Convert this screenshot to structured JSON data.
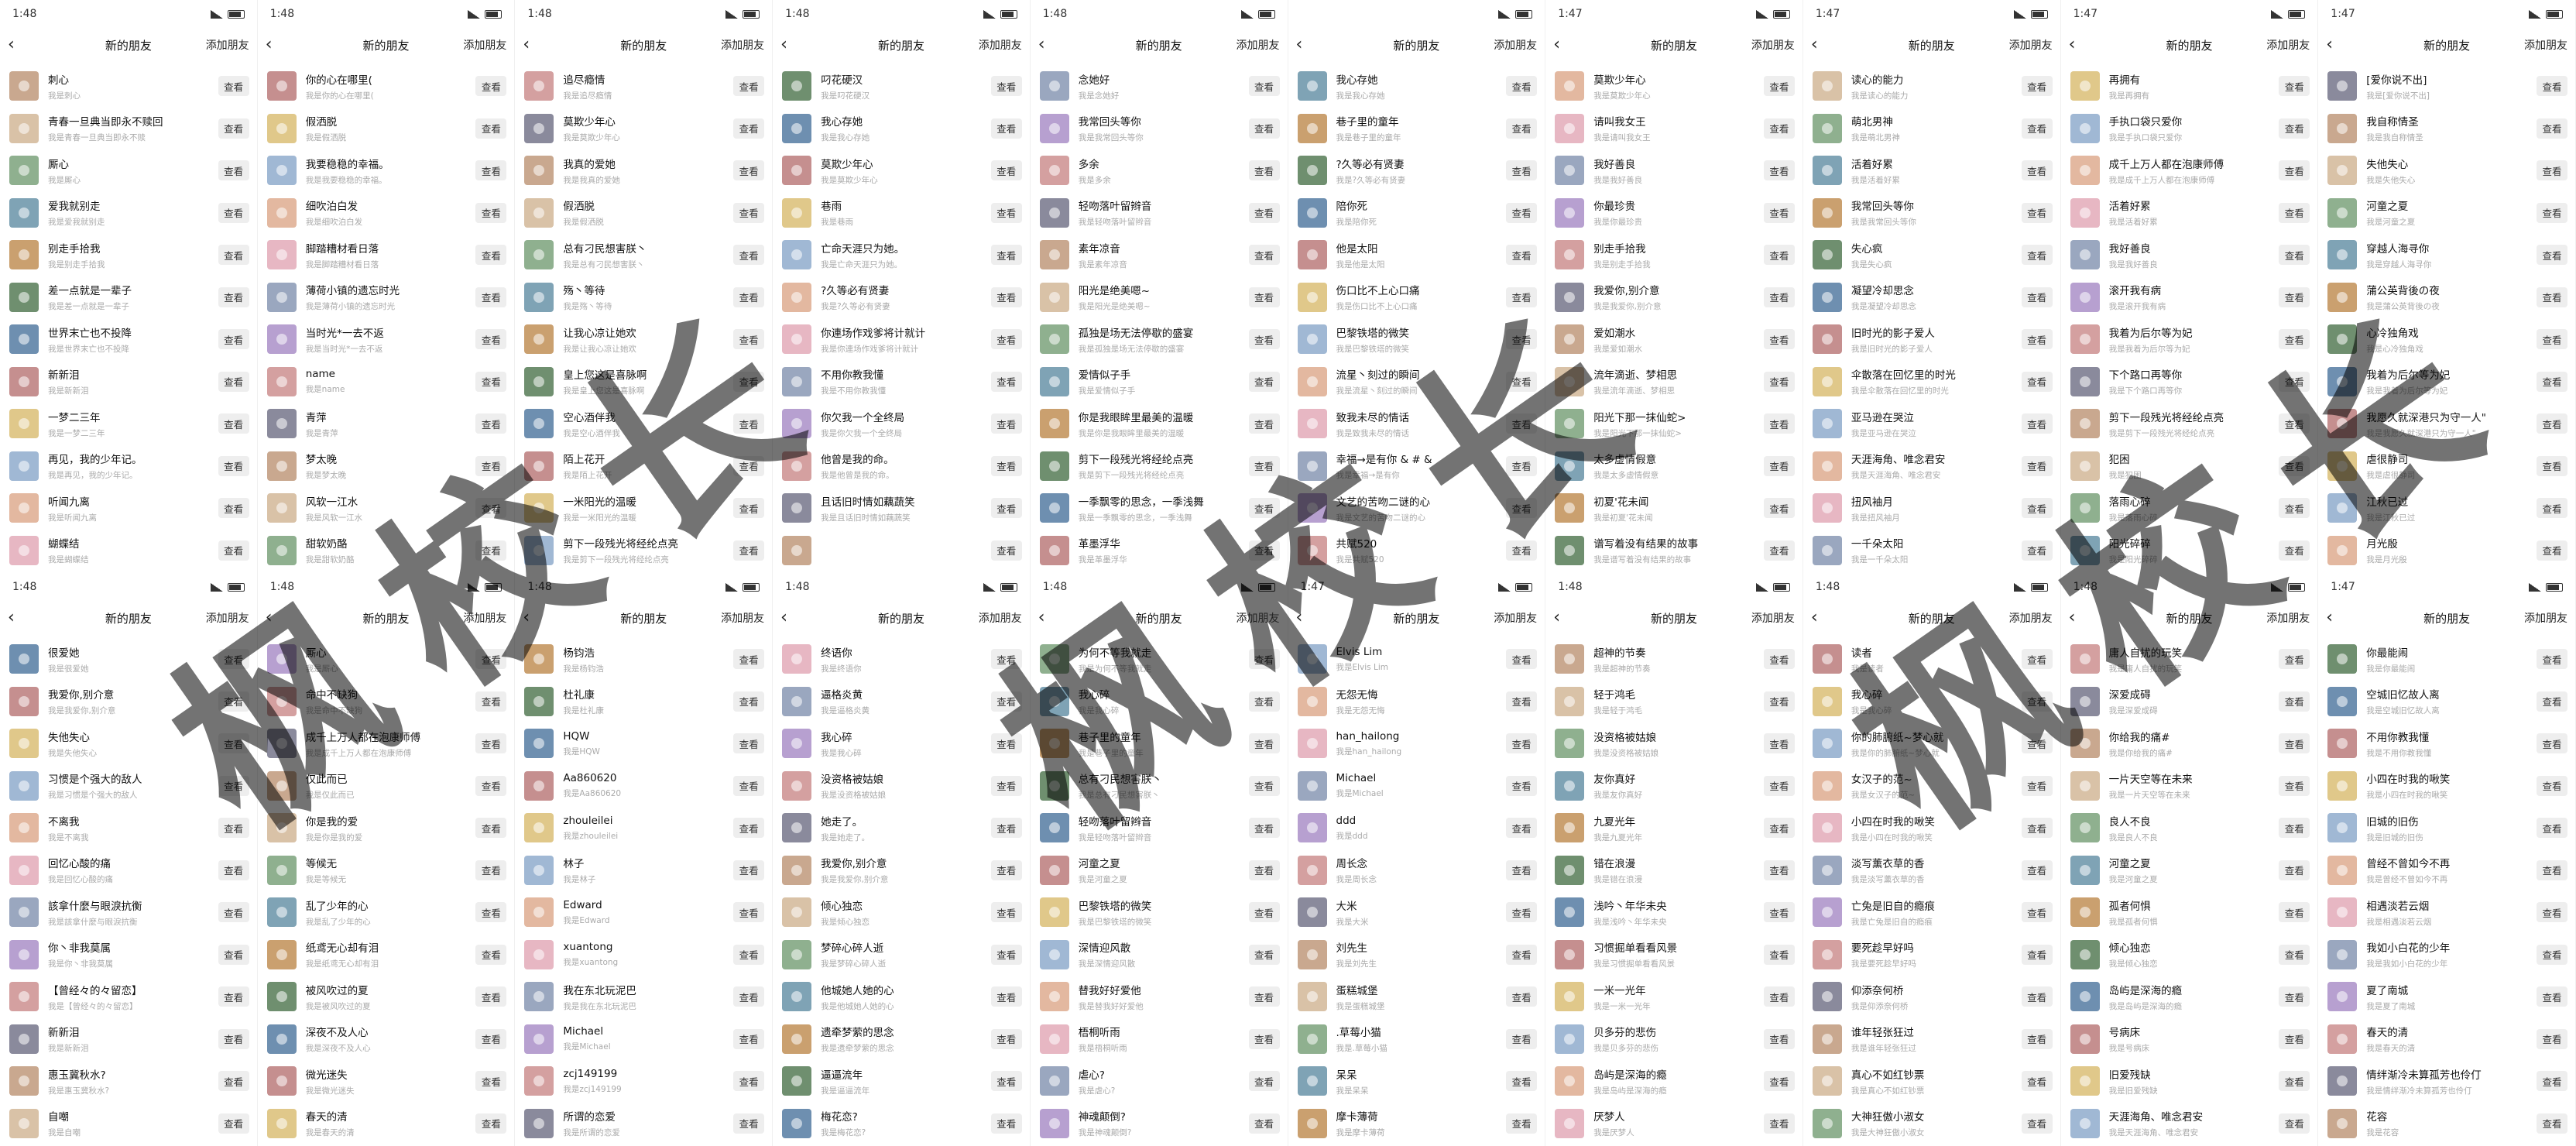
{
  "watermark": "枫校长",
  "ui": {
    "title": "新的朋友",
    "add_label": "添加朋友",
    "view_label": "查看"
  },
  "panels": [
    {
      "time": "1:48",
      "friends": [
        {
          "name": "刺心",
          "sub": "我是刺心"
        },
        {
          "name": "青春一旦典当即永不赎回",
          "sub": "我是青春一旦典当即永不赎"
        },
        {
          "name": "厮心",
          "sub": "我是厮心"
        },
        {
          "name": "爱我就别走",
          "sub": "我是爱我就别走"
        },
        {
          "name": "别走手拾我",
          "sub": "我是别走手拾我"
        },
        {
          "name": "差一点就是一辈子",
          "sub": "我是差一点就是一辈子"
        },
        {
          "name": "世界末亡也不投降",
          "sub": "我是世界末亡也不投降"
        },
        {
          "name": "新新泪",
          "sub": "我是新新泪"
        },
        {
          "name": "一梦二三年",
          "sub": "我是一梦二三年"
        },
        {
          "name": "再见，我的少年记。",
          "sub": "我是再见，我的少年记。"
        },
        {
          "name": "听闻九离",
          "sub": "我是听闻九离"
        },
        {
          "name": "蝴蝶结",
          "sub": "我是蝴蝶结"
        }
      ]
    },
    {
      "time": "1:48",
      "friends": [
        {
          "name": "你的心在哪里(",
          "sub": "我是你的心在哪里("
        },
        {
          "name": "假洒脱",
          "sub": "我是假洒脱"
        },
        {
          "name": "我要稳稳的幸福。",
          "sub": "我是我要稳稳的幸福。"
        },
        {
          "name": "细吹泊白发",
          "sub": "我是细吹泊白发"
        },
        {
          "name": "脚踏糟材看日落",
          "sub": "我是脚踏糟材看日落"
        },
        {
          "name": "薄荷小镇的遗忘时光",
          "sub": "我是薄荷小镇的遗忘时光"
        },
        {
          "name": "当时光*一去不返",
          "sub": "我是当时光*一去不返"
        },
        {
          "name": "name",
          "sub": "我是name"
        },
        {
          "name": "青萍",
          "sub": "我是青萍"
        },
        {
          "name": "梦太晚",
          "sub": "我是梦太晚"
        },
        {
          "name": "风软一江水",
          "sub": "我是风软一江水"
        },
        {
          "name": "甜软奶酪",
          "sub": "我是甜软奶酪"
        }
      ]
    },
    {
      "time": "1:48",
      "friends": [
        {
          "name": "追尽瘾情",
          "sub": "我是追尽瘾情"
        },
        {
          "name": "莫欺少年心",
          "sub": "我是莫欺少年心"
        },
        {
          "name": "我真的爱她",
          "sub": "我是我真的爱她"
        },
        {
          "name": "假洒脱",
          "sub": "我是假洒脱"
        },
        {
          "name": "总有刁民想害朕丶",
          "sub": "我是总有刁民想害朕丶"
        },
        {
          "name": "殇丶等待",
          "sub": "我是殇丶等待"
        },
        {
          "name": "让我心凉让她欢",
          "sub": "我是让我心凉让她欢"
        },
        {
          "name": "皇上您这是喜脉啊",
          "sub": "我是皇上您这是喜脉啊"
        },
        {
          "name": "空心酒伴我",
          "sub": "我是空心酒伴我"
        },
        {
          "name": "陌上花开",
          "sub": "我是陌上花开"
        },
        {
          "name": "一米阳光的温暖",
          "sub": "我是一米阳光的温暖"
        },
        {
          "name": "剪下一段残光将经纶点亮",
          "sub": "我是剪下一段残光将经纶点亮"
        }
      ]
    },
    {
      "time": "1:48",
      "friends": [
        {
          "name": "叼花硬汉",
          "sub": "我是叼花硬汉"
        },
        {
          "name": "我心存她",
          "sub": "我是我心存她"
        },
        {
          "name": "莫欺少年心",
          "sub": "我是莫欺少年心"
        },
        {
          "name": "巷雨",
          "sub": "我是巷雨"
        },
        {
          "name": "亡命天涯只为她。",
          "sub": "我是亡命天涯只为她。"
        },
        {
          "name": "?久等必有贤妻",
          "sub": "我是?久等必有贤妻"
        },
        {
          "name": "你連场作戏爹将计就计",
          "sub": "我是你連场作戏爹将计就计"
        },
        {
          "name": "不用你教我懂",
          "sub": "我是不用你教我懂"
        },
        {
          "name": "你欠我一个全终局",
          "sub": "我是你欠我一个全终局"
        },
        {
          "name": "他曾是我的命。",
          "sub": "我是他曾是我的命。"
        },
        {
          "name": "且话旧时情如藕蔬笑",
          "sub": "我是且话旧时情如藕蔬笑"
        },
        {
          "name": "",
          "sub": ""
        }
      ]
    },
    {
      "time": "1:48",
      "friends": [
        {
          "name": "念她好",
          "sub": "我是念她好"
        },
        {
          "name": "我常回头等你",
          "sub": "我是我常回头等你"
        },
        {
          "name": "多余",
          "sub": "我是多余"
        },
        {
          "name": "轻吻落叶留辫音",
          "sub": "我是轻吻落叶留辫音"
        },
        {
          "name": "素年凉音",
          "sub": "我是素年凉音"
        },
        {
          "name": "阳光是绝美嗯~",
          "sub": "我是阳光是绝美嗯~"
        },
        {
          "name": "孤独是场无法停歇的盛宴",
          "sub": "我是孤独是场无法停歇的盛宴"
        },
        {
          "name": "爱情似子手",
          "sub": "我是爱情似子手"
        },
        {
          "name": "你是我眼眸里最美的温暖",
          "sub": "我是你是我眼眸里最美的温暖"
        },
        {
          "name": "剪下一段残光将经纶点亮",
          "sub": "我是剪下一段残光将经纶点亮"
        },
        {
          "name": "一季飘零的思念，一季浅舞",
          "sub": "我是一季飘零的思念，一季浅舞"
        },
        {
          "name": "革墨浮华",
          "sub": "我是革墨浮华"
        }
      ]
    },
    {
      "time": "",
      "friends": [
        {
          "name": "我心存她",
          "sub": "我是我心存她"
        },
        {
          "name": "巷子里的童年",
          "sub": "我是巷子里的童年"
        },
        {
          "name": "?久等必有贤妻",
          "sub": "我是?久等必有贤妻"
        },
        {
          "name": "陪你死",
          "sub": "我是陪你死"
        },
        {
          "name": "他是太阳",
          "sub": "我是他是太阳"
        },
        {
          "name": "伤口比不上心口痛",
          "sub": "我是伤口比不上心口痛"
        },
        {
          "name": "巴黎铁塔的微笑",
          "sub": "我是巴黎铁塔的微笑"
        },
        {
          "name": "流星丶刻过的瞬间",
          "sub": "我是流星丶刻过的瞬间"
        },
        {
          "name": "致我未尽的情话",
          "sub": "我是致我未尽的情话"
        },
        {
          "name": "幸福→是有你 &  # &",
          "sub": "我是幸福→是有你"
        },
        {
          "name": "文艺的苦吻二谜的心",
          "sub": "我是文艺的苦吻二谜的心"
        },
        {
          "name": "共赋520",
          "sub": "我是共赋520"
        }
      ]
    },
    {
      "time": "1:47",
      "friends": [
        {
          "name": "莫欺少年心",
          "sub": "我是莫欺少年心"
        },
        {
          "name": "请叫我女王",
          "sub": "我是请叫我女王"
        },
        {
          "name": "我好善良",
          "sub": "我是我好善良"
        },
        {
          "name": "你最珍贵",
          "sub": "我是你最珍贵"
        },
        {
          "name": "别走手拾我",
          "sub": "我是别走手拾我"
        },
        {
          "name": "我爱你,别介意",
          "sub": "我是我爱你,别介意"
        },
        {
          "name": "爱如潮水",
          "sub": "我是爱如潮水"
        },
        {
          "name": "流年滴逝、梦相思",
          "sub": "我是流年滴逝、梦相思"
        },
        {
          "name": "阳光下那一抹仙蛇>",
          "sub": "我是阳光下那一抹仙蛇>"
        },
        {
          "name": "太多虚情假意",
          "sub": "我是太多虚情假意"
        },
        {
          "name": "初夏'花未闻",
          "sub": "我是初夏'花未闻"
        },
        {
          "name": "谱写着没有结果的故事",
          "sub": "我是谱写着没有结果的故事"
        }
      ]
    },
    {
      "time": "1:47",
      "friends": [
        {
          "name": "读心的能力",
          "sub": "我是读心的能力"
        },
        {
          "name": "萌北男神",
          "sub": "我是萌北男神"
        },
        {
          "name": "活着好累",
          "sub": "我是活着好累"
        },
        {
          "name": "我常回头等你",
          "sub": "我是我常回头等你"
        },
        {
          "name": "失心疯",
          "sub": "我是失心疯"
        },
        {
          "name": "凝望冷却思念",
          "sub": "我是凝望冷却思念"
        },
        {
          "name": "旧时光的影子爱人",
          "sub": "我是旧时光的影子爱人"
        },
        {
          "name": "伞散落在回忆里的时光",
          "sub": "我是伞散落在回忆里的时光"
        },
        {
          "name": "亚马逊在哭泣",
          "sub": "我是亚马逊在哭泣"
        },
        {
          "name": "天涯海角、唯念君安",
          "sub": "我是天涯海角、唯念君安"
        },
        {
          "name": "扭风袖月",
          "sub": "我是扭风袖月"
        },
        {
          "name": "一千朵太阳",
          "sub": "我是一千朵太阳"
        }
      ]
    },
    {
      "time": "1:47",
      "friends": [
        {
          "name": "再拥有",
          "sub": "我是再拥有"
        },
        {
          "name": "手执口袋只爱你",
          "sub": "我是手执口袋只爱你"
        },
        {
          "name": "成千上万人都在泡康师傅",
          "sub": "我是成千上万人都在泡康师傅"
        },
        {
          "name": "活着好累",
          "sub": "我是活着好累"
        },
        {
          "name": "我好善良",
          "sub": "我是我好善良"
        },
        {
          "name": "滚开我有病",
          "sub": "我是滚开我有病"
        },
        {
          "name": "我着为后尔等为妃",
          "sub": "我是我着为后尔等为妃"
        },
        {
          "name": "下个路口再等你",
          "sub": "我是下个路口再等你"
        },
        {
          "name": "剪下一段残光将经纶点亮",
          "sub": "我是剪下一段残光将经纶点亮"
        },
        {
          "name": "犯困",
          "sub": "我是犯困"
        },
        {
          "name": "落雨心碎",
          "sub": "我是落雨心碎"
        },
        {
          "name": "阳光碎碎",
          "sub": "我是阳光碎碎"
        }
      ]
    },
    {
      "time": "1:47",
      "friends": [
        {
          "name": "[爱你说不出]",
          "sub": "我是[爱你说不出]"
        },
        {
          "name": "我自称情圣",
          "sub": "我是我自称情圣"
        },
        {
          "name": "失他失心",
          "sub": "我是失他失心"
        },
        {
          "name": "河童之夏",
          "sub": "我是河童之夏"
        },
        {
          "name": "穿越人海寻你",
          "sub": "我是穿越人海寻你"
        },
        {
          "name": "蒲公英背後の夜",
          "sub": "我是蒲公英背後の夜"
        },
        {
          "name": "心冷独角戏",
          "sub": "我是心冷独角戏"
        },
        {
          "name": "我着为后尔等为妃",
          "sub": "我是我着为后尔等为妃"
        },
        {
          "name": "我愿久就深港只为守一人\"",
          "sub": "我是我愿久就深港只为守一人\""
        },
        {
          "name": "虐很静司",
          "sub": "我是虐很静司"
        },
        {
          "name": "江秋已过",
          "sub": "我是江秋已过"
        },
        {
          "name": "月光殷",
          "sub": "我是月光殷"
        }
      ]
    },
    {
      "time": "1:48",
      "friends": [
        {
          "name": "很爱她",
          "sub": "我是很爱她"
        },
        {
          "name": "我爱你,别介意",
          "sub": "我是我爱你,别介意"
        },
        {
          "name": "失他失心",
          "sub": "我是失他失心"
        },
        {
          "name": "习惯是个强大的敌人",
          "sub": "我是习惯是个强大的敌人"
        },
        {
          "name": "不离我",
          "sub": "我是不离我"
        },
        {
          "name": "回忆心酸的痛",
          "sub": "我是回忆心酸的痛"
        },
        {
          "name": "該拿什麼与眼淚抗衡",
          "sub": "我是該拿什麼与眼淚抗衡"
        },
        {
          "name": "你丶非我莫属",
          "sub": "我是你丶非我莫属"
        },
        {
          "name": "【曾经々的々留恋】",
          "sub": "我是【曾经々的々留恋】"
        },
        {
          "name": "新新泪",
          "sub": "我是新新泪"
        },
        {
          "name": "惠玉冀秋水?",
          "sub": "我是惠玉冀秋水?"
        },
        {
          "name": "自嘲",
          "sub": "我是自嘲"
        }
      ]
    },
    {
      "time": "1:48",
      "friends": [
        {
          "name": "厮心",
          "sub": "我是厮心"
        },
        {
          "name": "命中不缺狗",
          "sub": "我是命中不缺狗"
        },
        {
          "name": "成千上万人都在泡康师傅",
          "sub": "我是成千上万人都在泡康师傅"
        },
        {
          "name": "仅此而已",
          "sub": "我是仅此而已"
        },
        {
          "name": "你是我的爱",
          "sub": "我是你是我的爱"
        },
        {
          "name": "等候无",
          "sub": "我是等候无"
        },
        {
          "name": "乱了少年的心",
          "sub": "我是乱了少年的心"
        },
        {
          "name": "纸鸢无心却有泪",
          "sub": "我是纸鸢无心却有泪"
        },
        {
          "name": "被风吹过的夏",
          "sub": "我是被风吹过的夏"
        },
        {
          "name": "深夜不及人心",
          "sub": "我是深夜不及人心"
        },
        {
          "name": "微光迷失",
          "sub": "我是微光迷失"
        },
        {
          "name": "春天的清",
          "sub": "我是春天的清"
        }
      ]
    },
    {
      "time": "1:48",
      "friends": [
        {
          "name": "杨钧浩",
          "sub": "我是杨钧浩"
        },
        {
          "name": "杜礼康",
          "sub": "我是杜礼康"
        },
        {
          "name": "HQW",
          "sub": "我是HQW"
        },
        {
          "name": "Aa860620",
          "sub": "我是Aa860620"
        },
        {
          "name": "zhouleilei",
          "sub": "我是zhouleilei"
        },
        {
          "name": "林子",
          "sub": "我是林子"
        },
        {
          "name": "Edward",
          "sub": "我是Edward"
        },
        {
          "name": "xuantong",
          "sub": "我是xuantong"
        },
        {
          "name": "我在东北玩泥巴",
          "sub": "我是我在东北玩泥巴"
        },
        {
          "name": "Michael",
          "sub": "我是Michael"
        },
        {
          "name": "zcj149199",
          "sub": "我是zcj149199"
        },
        {
          "name": "所谓的恋爱",
          "sub": "我是所谓的恋爱"
        }
      ]
    },
    {
      "time": "1:48",
      "friends": [
        {
          "name": "终语你",
          "sub": "我是终语你"
        },
        {
          "name": "逼格炎黄",
          "sub": "我是逼格炎黄"
        },
        {
          "name": "我心碎",
          "sub": "我是我心碎"
        },
        {
          "name": "没资格被姑娘",
          "sub": "我是没资格被姑娘"
        },
        {
          "name": "她走了。",
          "sub": "我是她走了。"
        },
        {
          "name": "我爱你,别介意",
          "sub": "我是我爱你,别介意"
        },
        {
          "name": "倾心独恋",
          "sub": "我是倾心独恋"
        },
        {
          "name": "梦碎心碎人逝",
          "sub": "我是梦碎心碎人逝"
        },
        {
          "name": "他城她人她的心",
          "sub": "我是他城她人她的心"
        },
        {
          "name": "遗牵梦萦的思念",
          "sub": "我是遗牵梦萦的思念"
        },
        {
          "name": "逼逼流年",
          "sub": "我是逼逼流年"
        },
        {
          "name": "梅花恋?",
          "sub": "我是梅花恋?"
        }
      ]
    },
    {
      "time": "1:48",
      "friends": [
        {
          "name": "为何不等我就走",
          "sub": "我是为何不等我就走"
        },
        {
          "name": "我心碎",
          "sub": "我是我心碎"
        },
        {
          "name": "巷子里的童年",
          "sub": "我是巷子里的童年"
        },
        {
          "name": "总有刁民想害朕丶",
          "sub": "我是总有刁民想害朕丶"
        },
        {
          "name": "轻吻落叶留辫音",
          "sub": "我是轻吻落叶留辫音"
        },
        {
          "name": "河童之夏",
          "sub": "我是河童之夏"
        },
        {
          "name": "巴黎铁塔的微笑",
          "sub": "我是巴黎铁塔的微笑"
        },
        {
          "name": "深情迎风散",
          "sub": "我是深情迎风散"
        },
        {
          "name": "替我好好爱他",
          "sub": "我是替我好好爱他"
        },
        {
          "name": "梧桐听雨",
          "sub": "我是梧桐听雨"
        },
        {
          "name": "虐心?",
          "sub": "我是虐心?"
        },
        {
          "name": "神魂颠倒?",
          "sub": "我是神魂颠倒?"
        }
      ]
    },
    {
      "time": "1:47",
      "friends": [
        {
          "name": "Elvis Lim",
          "sub": "我是Elvis Lim"
        },
        {
          "name": "无怨无悔",
          "sub": "我是无怨无悔"
        },
        {
          "name": "han_hailong",
          "sub": "我是han_hailong"
        },
        {
          "name": "Michael",
          "sub": "我是Michael"
        },
        {
          "name": "ddd",
          "sub": "我是ddd"
        },
        {
          "name": "周长念",
          "sub": "我是周长念"
        },
        {
          "name": "大米",
          "sub": "我是大米"
        },
        {
          "name": "刘先生",
          "sub": "我是刘先生"
        },
        {
          "name": "蛋糕城堡",
          "sub": "我是蛋糕城堡"
        },
        {
          "name": ".草莓小猫",
          "sub": "我是.草莓小猫"
        },
        {
          "name": "呆呆",
          "sub": "我是呆呆"
        },
        {
          "name": "摩卡薄荷",
          "sub": "我是摩卡薄荷"
        }
      ]
    },
    {
      "time": "1:48",
      "friends": [
        {
          "name": "超神的节奏",
          "sub": "我是超神的节奏"
        },
        {
          "name": "轻于鸿毛",
          "sub": "我是轻于鸿毛"
        },
        {
          "name": "没资格被姑娘",
          "sub": "我是没资格被姑娘"
        },
        {
          "name": "友你真好",
          "sub": "我是友你真好"
        },
        {
          "name": "九夏光年",
          "sub": "我是九夏光年"
        },
        {
          "name": "错在浪漫",
          "sub": "我是错在浪漫"
        },
        {
          "name": "浅吟丶年华未央",
          "sub": "我是浅吟丶年华未央"
        },
        {
          "name": "习惯掘单看看风景",
          "sub": "我是习惯掘单看看风景"
        },
        {
          "name": "一米一光年",
          "sub": "我是一米一光年"
        },
        {
          "name": "贝多芬的悲伤",
          "sub": "我是贝多芬的悲伤"
        },
        {
          "name": "岛屿是深海的瘾",
          "sub": "我是岛屿是深海的瘾"
        },
        {
          "name": "厌梦人",
          "sub": "我是厌梦人"
        }
      ]
    },
    {
      "time": "1:48",
      "friends": [
        {
          "name": "读者",
          "sub": "我是读者"
        },
        {
          "name": "我心碎",
          "sub": "我是我心碎"
        },
        {
          "name": "你的肺腑纸~梦心就",
          "sub": "我是你的肺腑纸~梦心就"
        },
        {
          "name": "女汉子的范~",
          "sub": "我是女汉子的范~"
        },
        {
          "name": "小四在时我的啾笑",
          "sub": "我是小四在时我的啾笑"
        },
        {
          "name": "淡写薰衣草的香",
          "sub": "我是淡写薰衣草的香"
        },
        {
          "name": "亡兔是旧自的瘾痕",
          "sub": "我是亡兔是旧自的瘾痕"
        },
        {
          "name": "要死趁早好吗",
          "sub": "我是要死趁早好吗"
        },
        {
          "name": "仰添奈何桥",
          "sub": "我是仰添奈何桥"
        },
        {
          "name": "谁年轻张狂过",
          "sub": "我是谁年轻张狂过"
        },
        {
          "name": "真心不如红钞票",
          "sub": "我是真心不如红钞票"
        },
        {
          "name": "大神狂傲小淑女",
          "sub": "我是大神狂傲小淑女"
        }
      ]
    },
    {
      "time": "1:48",
      "friends": [
        {
          "name": "庸人自扰的玩笑",
          "sub": "我是庸人自扰的玩笑"
        },
        {
          "name": "深爱成碍",
          "sub": "我是深爱成碍"
        },
        {
          "name": "你给我的痛#",
          "sub": "我是你给我的痛#"
        },
        {
          "name": "一片天空等在未来",
          "sub": "我是一片天空等在未来"
        },
        {
          "name": "良人不良",
          "sub": "我是良人不良"
        },
        {
          "name": "河童之夏",
          "sub": "我是河童之夏"
        },
        {
          "name": "孤者何惧",
          "sub": "我是孤者何惧"
        },
        {
          "name": "倾心独恋",
          "sub": "我是倾心独恋"
        },
        {
          "name": "岛屿是深海的瘾",
          "sub": "我是岛屿是深海的瘾"
        },
        {
          "name": "号病床",
          "sub": "我是号病床"
        },
        {
          "name": "旧爱残缺",
          "sub": "我是旧爱残缺"
        },
        {
          "name": "天涯海角、唯念君安",
          "sub": "我是天涯海角、唯念君安"
        }
      ]
    },
    {
      "time": "1:47",
      "friends": [
        {
          "name": "你最能闹",
          "sub": "我是你最能闹"
        },
        {
          "name": "空城旧忆故人离",
          "sub": "我是空城旧忆故人离"
        },
        {
          "name": "不用你教我懂",
          "sub": "我是不用你教我懂"
        },
        {
          "name": "小四在时我的啾笑",
          "sub": "我是小四在时我的啾笑"
        },
        {
          "name": "旧城的旧伤",
          "sub": "我是旧城的旧伤"
        },
        {
          "name": "曾经不曾如今不再",
          "sub": "我是曾经不曾如今不再"
        },
        {
          "name": "相遇淡若云烟",
          "sub": "我是相遇淡若云烟"
        },
        {
          "name": "我如小白花的少年",
          "sub": "我是我如小白花的少年"
        },
        {
          "name": "夏了南城",
          "sub": "我是夏了南城"
        },
        {
          "name": "春天的清",
          "sub": "我是春天的清"
        },
        {
          "name": "情绊渐冷未算孤芳也伶仃",
          "sub": "我是情绊渐冷未算孤芳也伶仃"
        },
        {
          "name": "花容",
          "sub": "我是花容"
        }
      ]
    }
  ]
}
